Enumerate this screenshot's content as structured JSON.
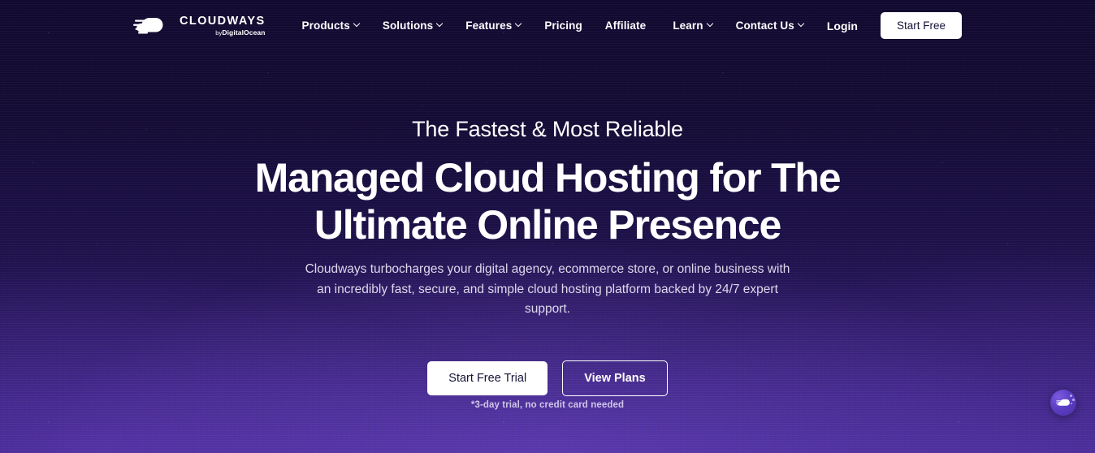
{
  "brand": {
    "name": "CLOUDWAYS",
    "sub_prefix": "by",
    "sub_name": "DigitalOcean",
    "logo_icon": "speeding-cloud-logo-icon"
  },
  "nav": {
    "items": [
      {
        "label": "Products",
        "has_dropdown": true,
        "icon": "chevron-down-icon"
      },
      {
        "label": "Solutions",
        "has_dropdown": true,
        "icon": "chevron-down-icon"
      },
      {
        "label": "Features",
        "has_dropdown": true,
        "icon": "chevron-down-icon"
      },
      {
        "label": "Pricing",
        "has_dropdown": false
      },
      {
        "label": "Affiliate",
        "has_dropdown": false
      }
    ]
  },
  "utility_nav": {
    "items": [
      {
        "label": "Learn",
        "has_dropdown": true,
        "icon": "chevron-down-icon"
      },
      {
        "label": "Contact Us",
        "has_dropdown": true,
        "icon": "chevron-down-icon"
      }
    ],
    "login_label": "Login",
    "start_free_label": "Start Free"
  },
  "hero": {
    "eyebrow": "The Fastest & Most Reliable",
    "title_line1": "Managed Cloud Hosting for The",
    "title_line2": "Ultimate Online Presence",
    "description": "Cloudways turbocharges your digital agency, ecommerce store, or online business with an incredibly fast, secure, and simple cloud hosting platform backed by 24/7 expert support.",
    "primary_cta": "Start Free Trial",
    "secondary_cta": "View Plans",
    "disclaimer": "*3-day trial, no credit card needed"
  },
  "chat_widget": {
    "icon": "cloud-chat-bubble-icon"
  },
  "colors": {
    "bg_top": "#120a30",
    "bg_bottom": "#3d2588",
    "accent_purple": "#5b3fc4",
    "text_primary": "#ffffff",
    "text_muted": "#ded9ec",
    "button_dark_text": "#151339"
  }
}
